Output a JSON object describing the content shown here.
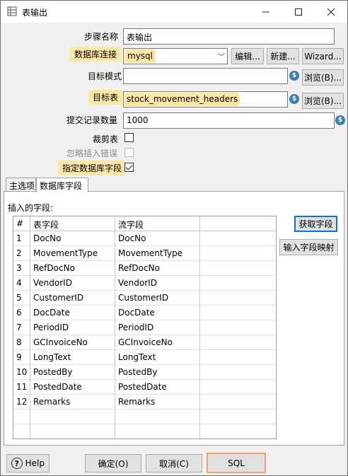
{
  "window": {
    "title": "表输出",
    "icons": {
      "app": "table-output-icon",
      "minimize": "minimize-icon",
      "maximize": "maximize-icon",
      "close": "close-icon"
    }
  },
  "form": {
    "step_name_label": "步骤名称",
    "step_name_value": "表输出",
    "db_connection_label": "数据库连接",
    "db_connection_value": "mysql",
    "edit_button": "编辑...",
    "new_button": "新建...",
    "wizard_button": "Wizard...",
    "target_schema_label": "目标模式",
    "target_schema_value": "",
    "browse_button_1": "浏览(B)...",
    "target_table_label": "目标表",
    "target_table_value": "stock_movement_headers",
    "browse_button_2": "浏览(B)...",
    "commit_size_label": "提交记录数量",
    "commit_size_value": "1000",
    "truncate_label": "裁剪表",
    "truncate_checked": false,
    "ignore_errors_label": "忽略插入错误",
    "ignore_errors_checked": false,
    "specify_fields_label": "指定数据库字段",
    "specify_fields_checked": true,
    "variable_icon_text": "$"
  },
  "tabs": [
    {
      "label": "主选项",
      "active": false
    },
    {
      "label": "数据库字段",
      "active": true
    }
  ],
  "fields_panel": {
    "caption": "插入的字段:",
    "columns": [
      "#",
      "表字段",
      "流字段",
      ""
    ],
    "rows": [
      {
        "n": "1",
        "table_field": "DocNo",
        "stream_field": "DocNo"
      },
      {
        "n": "2",
        "table_field": "MovementType",
        "stream_field": "MovementType"
      },
      {
        "n": "3",
        "table_field": "RefDocNo",
        "stream_field": "RefDocNo"
      },
      {
        "n": "4",
        "table_field": "VendorID",
        "stream_field": "VendorID"
      },
      {
        "n": "5",
        "table_field": "CustomerID",
        "stream_field": "CustomerID"
      },
      {
        "n": "6",
        "table_field": "DocDate",
        "stream_field": "DocDate"
      },
      {
        "n": "7",
        "table_field": "PeriodID",
        "stream_field": "PeriodID"
      },
      {
        "n": "8",
        "table_field": "GCInvoiceNo",
        "stream_field": "GCInvoiceNo"
      },
      {
        "n": "9",
        "table_field": "LongText",
        "stream_field": "LongText"
      },
      {
        "n": "10",
        "table_field": "PostedBy",
        "stream_field": "PostedBy"
      },
      {
        "n": "11",
        "table_field": "PostedDate",
        "stream_field": "PostedDate"
      },
      {
        "n": "12",
        "table_field": "Remarks",
        "stream_field": "Remarks"
      }
    ],
    "get_fields_button": "获取字段",
    "enter_mapping_button": "输入字段映射"
  },
  "footer": {
    "help_button": "Help",
    "ok_button": "确定(O)",
    "cancel_button": "取消(C)",
    "sql_button": "SQL"
  },
  "colors": {
    "highlight": "#fbe6a2",
    "sql_border": "#f0a070",
    "primary_border": "#0078d7"
  }
}
